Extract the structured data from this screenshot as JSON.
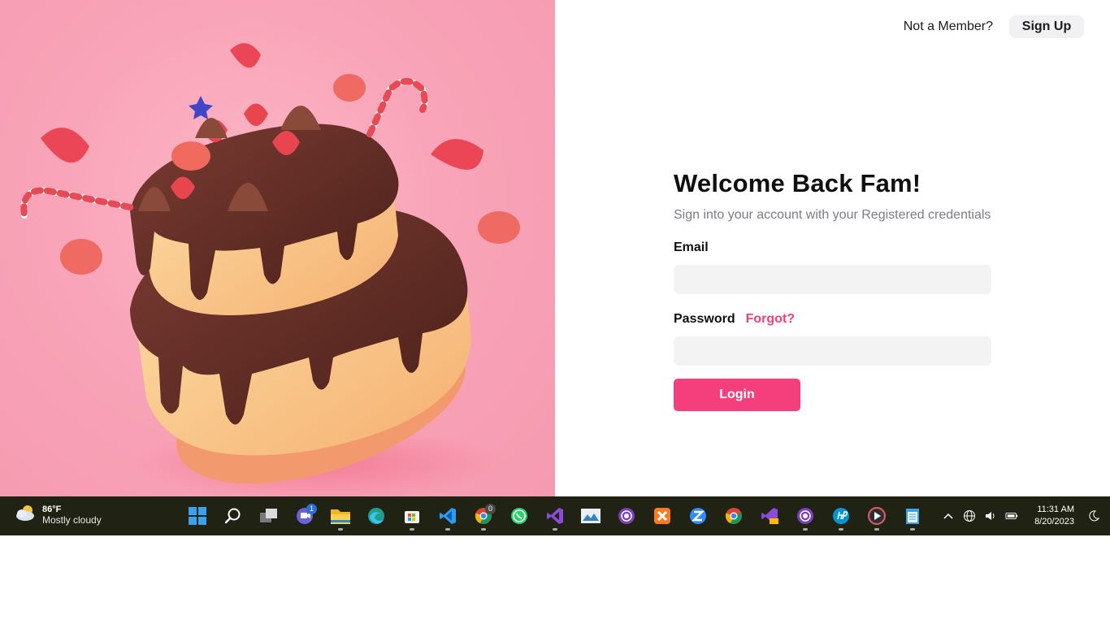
{
  "header": {
    "prompt": "Not a Member?",
    "signup_label": "Sign Up"
  },
  "form": {
    "title": "Welcome Back Fam!",
    "subtitle": "Sign into your account with your Registered credentials",
    "email_label": "Email",
    "email_value": "",
    "password_label": "Password",
    "password_value": "",
    "forgot_label": "Forgot?",
    "login_label": "Login"
  },
  "hero": {
    "image_name": "chocolate-strawberry-cake-illustration"
  },
  "taskbar": {
    "weather": {
      "temp": "86°F",
      "desc": "Mostly cloudy"
    },
    "apps": [
      {
        "name": "start-icon",
        "badge": ""
      },
      {
        "name": "search-icon",
        "badge": ""
      },
      {
        "name": "task-view-icon",
        "badge": ""
      },
      {
        "name": "teams-chat-icon",
        "badge": "1"
      },
      {
        "name": "file-explorer-icon",
        "badge": ""
      },
      {
        "name": "edge-icon",
        "badge": ""
      },
      {
        "name": "microsoft-store-icon",
        "badge": ""
      },
      {
        "name": "vscode-icon",
        "badge": ""
      },
      {
        "name": "chrome-icon",
        "badge": "0"
      },
      {
        "name": "whatsapp-icon",
        "badge": ""
      },
      {
        "name": "visual-studio-icon",
        "badge": ""
      },
      {
        "name": "photos-icon",
        "badge": ""
      },
      {
        "name": "tor-browser-icon",
        "badge": ""
      },
      {
        "name": "xampp-icon",
        "badge": ""
      },
      {
        "name": "zoom-icon",
        "badge": ""
      },
      {
        "name": "chrome-secondary-icon",
        "badge": ""
      },
      {
        "name": "visual-studio-preview-icon",
        "badge": ""
      },
      {
        "name": "tor-browser-secondary-icon",
        "badge": ""
      },
      {
        "name": "hp-icon",
        "badge": ""
      },
      {
        "name": "media-player-icon",
        "badge": ""
      },
      {
        "name": "notepad-icon",
        "badge": ""
      }
    ],
    "clock": {
      "time": "11:31 AM",
      "date": "8/20/2023"
    }
  },
  "colors": {
    "accent": "#f43f7c",
    "forgot": "#ee3f79",
    "hero_bg": "#f9a4b8",
    "taskbar_bg": "#202213"
  }
}
